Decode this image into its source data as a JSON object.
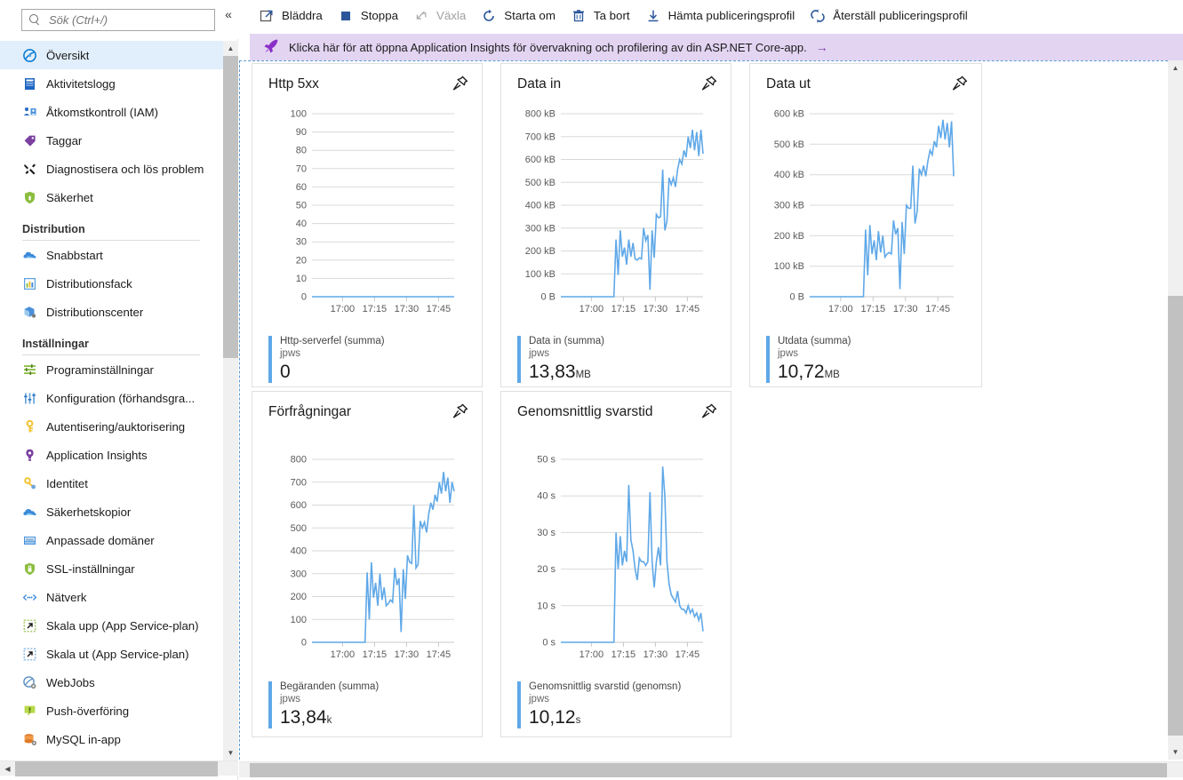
{
  "sidebar": {
    "search": {
      "placeholder": "Sök (Ctrl+/)",
      "value": ""
    },
    "collapse_label": "«",
    "items": [
      {
        "label": "Översikt",
        "icon": "overview-icon",
        "selected": true
      },
      {
        "label": "Aktivitetslogg",
        "icon": "activity-log-icon",
        "selected": false
      },
      {
        "label": "Åtkomstkontroll (IAM)",
        "icon": "access-control-icon",
        "selected": false
      },
      {
        "label": "Taggar",
        "icon": "tag-icon",
        "selected": false
      },
      {
        "label": "Diagnostisera och lös problem",
        "icon": "diagnose-icon",
        "selected": false
      },
      {
        "label": "Säkerhet",
        "icon": "security-shield-icon",
        "selected": false
      }
    ],
    "sections": [
      {
        "title": "Distribution",
        "items": [
          {
            "label": "Snabbstart",
            "icon": "quickstart-cloud-icon"
          },
          {
            "label": "Distributionsfack",
            "icon": "deployment-slots-icon"
          },
          {
            "label": "Distributionscenter",
            "icon": "deployment-center-icon"
          }
        ]
      },
      {
        "title": "Inställningar",
        "items": [
          {
            "label": "Programinställningar",
            "icon": "app-settings-icon"
          },
          {
            "label": "Konfiguration (förhandsgra...",
            "icon": "configuration-icon"
          },
          {
            "label": "Autentisering/auktorisering",
            "icon": "auth-key-icon"
          },
          {
            "label": "Application Insights",
            "icon": "app-insights-icon"
          },
          {
            "label": "Identitet",
            "icon": "identity-key-icon"
          },
          {
            "label": "Säkerhetskopior",
            "icon": "backup-cloud-icon"
          },
          {
            "label": "Anpassade domäner",
            "icon": "custom-domains-icon"
          },
          {
            "label": "SSL-inställningar",
            "icon": "ssl-shield-icon"
          },
          {
            "label": "Nätverk",
            "icon": "networking-icon"
          },
          {
            "label": "Skala upp (App Service-plan)",
            "icon": "scale-up-icon"
          },
          {
            "label": "Skala ut (App Service-plan)",
            "icon": "scale-out-icon"
          },
          {
            "label": "WebJobs",
            "icon": "webjobs-icon"
          },
          {
            "label": "Push-överföring",
            "icon": "push-icon"
          },
          {
            "label": "MySQL in-app",
            "icon": "mysql-icon"
          }
        ]
      }
    ]
  },
  "toolbar": {
    "buttons": [
      {
        "label": "Bläddra",
        "icon": "open-external-icon",
        "disabled": false
      },
      {
        "label": "Stoppa",
        "icon": "stop-square-icon",
        "disabled": false
      },
      {
        "label": "Växla",
        "icon": "swap-icon",
        "disabled": true
      },
      {
        "label": "Starta om",
        "icon": "restart-icon",
        "disabled": false
      },
      {
        "label": "Ta bort",
        "icon": "trash-icon",
        "disabled": false
      },
      {
        "label": "Hämta publiceringsprofil",
        "icon": "download-icon",
        "disabled": false
      },
      {
        "label": "Återställ publiceringsprofil",
        "icon": "reset-refresh-icon",
        "disabled": false
      }
    ]
  },
  "banner": {
    "icon": "rocket-icon",
    "text": "Klicka här för att öppna Application Insights för övervakning och profilering av din ASP.NET Core-app.",
    "arrow": "→",
    "background": "#e3d4f2"
  },
  "accent_color": "#5fa8e8",
  "tiles": [
    {
      "title": "Http 5xx",
      "pin": "pin-icon",
      "legend_title": "Http-serverfel (summa)",
      "legend_sub": "jpws",
      "value": "0",
      "unit": ""
    },
    {
      "title": "Data in",
      "pin": "pin-icon",
      "legend_title": "Data in (summa)",
      "legend_sub": "jpws",
      "value": "13,83",
      "unit": "MB"
    },
    {
      "title": "Data ut",
      "pin": "pin-icon",
      "legend_title": "Utdata (summa)",
      "legend_sub": "jpws",
      "value": "10,72",
      "unit": "MB"
    },
    {
      "title": "Förfrågningar",
      "pin": "pin-icon",
      "legend_title": "Begäranden (summa)",
      "legend_sub": "jpws",
      "value": "13,84",
      "unit": "k"
    },
    {
      "title": "Genomsnittlig svarstid",
      "pin": "pin-icon",
      "legend_title": "Genomsnittlig svarstid (genomsn)",
      "legend_sub": "jpws",
      "value": "10,12",
      "unit": "s"
    }
  ],
  "chart_data": [
    {
      "type": "line",
      "title": "Http 5xx",
      "xlabel": "",
      "ylabel": "",
      "series": [
        {
          "name": "Http-serverfel (summa)",
          "color": "#5fa8e8",
          "values": [
            0,
            0,
            0,
            0,
            0,
            0,
            0,
            0,
            0,
            0,
            0,
            0,
            0,
            0,
            0,
            0,
            0,
            0,
            0,
            0,
            0,
            0,
            0,
            0,
            0,
            0,
            0,
            0,
            0,
            0,
            0,
            0,
            0,
            0,
            0,
            0,
            0,
            0,
            0,
            0,
            0,
            0,
            0,
            0,
            0,
            0,
            0,
            0,
            0,
            0,
            0,
            0,
            0,
            0,
            0,
            0,
            0,
            0,
            0,
            0
          ]
        }
      ],
      "ylim": [
        0,
        100
      ],
      "yticks": [
        0,
        10,
        20,
        30,
        40,
        50,
        60,
        70,
        80,
        90,
        100
      ],
      "yticklabels": [
        "0",
        "10",
        "20",
        "30",
        "40",
        "50",
        "60",
        "70",
        "80",
        "90",
        "100"
      ],
      "xticklabels": [
        "17:00",
        "17:15",
        "17:30",
        "17:45"
      ],
      "grid": true,
      "legend_position": "below"
    },
    {
      "type": "line",
      "title": "Data in",
      "xlabel": "",
      "ylabel": "",
      "series": [
        {
          "name": "Data in (summa)",
          "color": "#5fa8e8",
          "values": [
            0,
            0,
            0,
            0,
            0,
            0,
            0,
            0,
            0,
            0,
            0,
            0,
            0,
            0,
            0,
            0,
            0,
            0,
            0,
            0,
            0,
            0,
            0,
            0,
            0,
            0,
            250000,
            95000,
            290000,
            175000,
            215000,
            140000,
            250000,
            175000,
            235000,
            165000,
            160000,
            170000,
            165000,
            300000,
            245000,
            270000,
            30000,
            290000,
            170000,
            360000,
            345000,
            350000,
            555000,
            290000,
            330000,
            520000,
            490000,
            520000,
            480000,
            555000,
            600000,
            580000,
            640000,
            610000,
            700000,
            650000,
            730000,
            640000,
            720000,
            615000,
            730000,
            625000
          ],
          "unit": "B"
        }
      ],
      "ylim": [
        0,
        800000
      ],
      "yticks": [
        0,
        100000,
        200000,
        300000,
        400000,
        500000,
        600000,
        700000,
        800000
      ],
      "yticklabels": [
        "0 B",
        "100 kB",
        "200 kB",
        "300 kB",
        "400 kB",
        "500 kB",
        "600 kB",
        "700 kB",
        "800 kB"
      ],
      "xticklabels": [
        "17:00",
        "17:15",
        "17:30",
        "17:45"
      ],
      "grid": true,
      "legend_position": "below"
    },
    {
      "type": "line",
      "title": "Data ut",
      "xlabel": "",
      "ylabel": "",
      "series": [
        {
          "name": "Utdata (summa)",
          "color": "#5fa8e8",
          "values": [
            0,
            0,
            0,
            0,
            0,
            0,
            0,
            0,
            0,
            0,
            0,
            0,
            0,
            0,
            0,
            0,
            0,
            0,
            0,
            0,
            0,
            0,
            0,
            0,
            0,
            0,
            220000,
            70000,
            235000,
            140000,
            185000,
            120000,
            215000,
            145000,
            200000,
            130000,
            140000,
            145000,
            140000,
            250000,
            205000,
            225000,
            25000,
            245000,
            140000,
            300000,
            290000,
            290000,
            430000,
            240000,
            280000,
            420000,
            400000,
            430000,
            395000,
            445000,
            480000,
            465000,
            510000,
            490000,
            560000,
            520000,
            580000,
            515000,
            570000,
            490000,
            575000,
            395000
          ],
          "unit": "B"
        }
      ],
      "ylim": [
        0,
        600000
      ],
      "yticks": [
        0,
        100000,
        200000,
        300000,
        400000,
        500000,
        600000
      ],
      "yticklabels": [
        "0 B",
        "100 kB",
        "200 kB",
        "300 kB",
        "400 kB",
        "500 kB",
        "600 kB"
      ],
      "xticklabels": [
        "17:00",
        "17:15",
        "17:30",
        "17:45"
      ],
      "grid": true,
      "legend_position": "below"
    },
    {
      "type": "line",
      "title": "Förfrågningar",
      "xlabel": "",
      "ylabel": "",
      "series": [
        {
          "name": "Begäranden (summa)",
          "color": "#5fa8e8",
          "values": [
            0,
            0,
            0,
            0,
            0,
            0,
            0,
            0,
            0,
            0,
            0,
            0,
            0,
            0,
            0,
            0,
            0,
            0,
            0,
            0,
            0,
            0,
            0,
            0,
            0,
            0,
            305,
            100,
            350,
            195,
            260,
            160,
            300,
            185,
            240,
            160,
            170,
            185,
            175,
            325,
            250,
            280,
            45,
            320,
            190,
            380,
            350,
            345,
            600,
            325,
            340,
            530,
            500,
            525,
            480,
            560,
            610,
            580,
            645,
            615,
            700,
            650,
            745,
            660,
            720,
            610,
            700,
            660
          ],
          "unit": "requests"
        }
      ],
      "ylim": [
        0,
        800
      ],
      "yticks": [
        0,
        100,
        200,
        300,
        400,
        500,
        600,
        700,
        800
      ],
      "yticklabels": [
        "0",
        "100",
        "200",
        "300",
        "400",
        "500",
        "600",
        "700",
        "800"
      ],
      "xticklabels": [
        "17:00",
        "17:15",
        "17:30",
        "17:45"
      ],
      "grid": true,
      "legend_position": "below"
    },
    {
      "type": "line",
      "title": "Genomsnittlig svarstid",
      "xlabel": "",
      "ylabel": "",
      "series": [
        {
          "name": "Genomsnittlig svarstid (genomsn)",
          "color": "#5fa8e8",
          "values": [
            0,
            0,
            0,
            0,
            0,
            0,
            0,
            0,
            0,
            0,
            0,
            0,
            0,
            0,
            0,
            0,
            0,
            0,
            0,
            0,
            0,
            0,
            0,
            0,
            0,
            0,
            30,
            20,
            29,
            21,
            25,
            22,
            43,
            28,
            25,
            20,
            17,
            23,
            22,
            22,
            21,
            22,
            41,
            22,
            15,
            22,
            26,
            21,
            48,
            40,
            22,
            16,
            13,
            12,
            11,
            14,
            10,
            9,
            9,
            8,
            10,
            8,
            9,
            7,
            8,
            6,
            8,
            3
          ],
          "unit": "s"
        }
      ],
      "ylim": [
        0,
        50
      ],
      "yticks": [
        0,
        10,
        20,
        30,
        40,
        50
      ],
      "yticklabels": [
        "0 s",
        "10 s",
        "20 s",
        "30 s",
        "40 s",
        "50 s"
      ],
      "xticklabels": [
        "17:00",
        "17:15",
        "17:30",
        "17:45"
      ],
      "grid": true,
      "legend_position": "below"
    }
  ]
}
